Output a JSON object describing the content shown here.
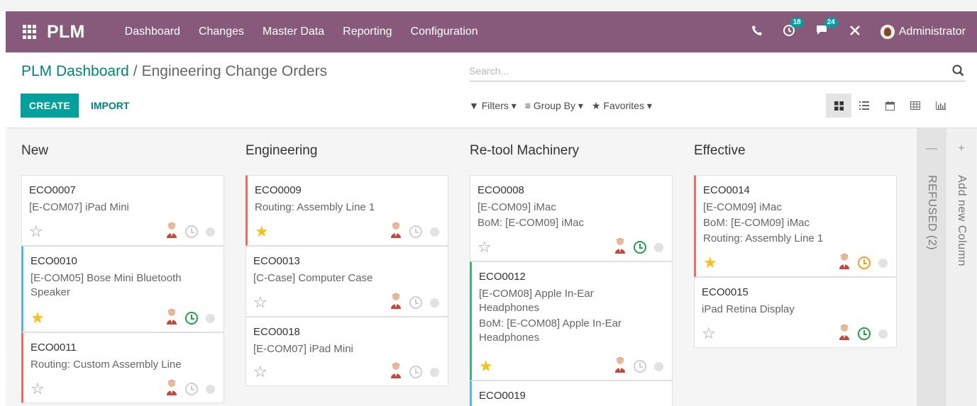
{
  "navbar": {
    "brand": "PLM",
    "menu": [
      "Dashboard",
      "Changes",
      "Master Data",
      "Reporting",
      "Configuration"
    ],
    "activities_count": "18",
    "messages_count": "24",
    "user": "Administrator",
    "background": "#875a7b"
  },
  "breadcrumb": {
    "parent": "PLM Dashboard",
    "separator": "/",
    "current": "Engineering Change Orders"
  },
  "search": {
    "placeholder": "Search..."
  },
  "buttons": {
    "create": "CREATE",
    "import": "IMPORT"
  },
  "filters": {
    "filters": "Filters",
    "group_by": "Group By",
    "favorites": "Favorites"
  },
  "kanban": {
    "columns": [
      {
        "title": "New",
        "cards": [
          {
            "ref": "ECO0007",
            "lines": [
              "[E-COM07] iPad Mini"
            ],
            "starred": false,
            "activity": "none",
            "color": ""
          },
          {
            "ref": "ECO0010",
            "lines": [
              "[E-COM05] Bose Mini Bluetooth Speaker"
            ],
            "starred": true,
            "activity": "green",
            "color": "blue"
          },
          {
            "ref": "ECO0011",
            "lines": [
              "Routing: Custom Assembly Line"
            ],
            "starred": false,
            "activity": "none",
            "color": "red"
          }
        ]
      },
      {
        "title": "Engineering",
        "cards": [
          {
            "ref": "ECO0009",
            "lines": [
              "Routing: Assembly Line 1"
            ],
            "starred": true,
            "activity": "none",
            "color": "red"
          },
          {
            "ref": "ECO0013",
            "lines": [
              "[C-Case] Computer Case"
            ],
            "starred": false,
            "activity": "none",
            "color": ""
          },
          {
            "ref": "ECO0018",
            "lines": [
              "[E-COM07] iPad Mini"
            ],
            "starred": false,
            "activity": "none",
            "color": ""
          }
        ]
      },
      {
        "title": "Re-tool Machinery",
        "cards": [
          {
            "ref": "ECO0008",
            "lines": [
              "[E-COM09] iMac",
              "BoM: [E-COM09] iMac"
            ],
            "starred": false,
            "activity": "green",
            "color": ""
          },
          {
            "ref": "ECO0012",
            "lines": [
              "[E-COM08] Apple In-Ear Headphones",
              "BoM: [E-COM08] Apple In-Ear Headphones"
            ],
            "starred": true,
            "activity": "none",
            "color": "green"
          },
          {
            "ref": "ECO0019",
            "lines": [],
            "starred": false,
            "activity": "none",
            "color": "blue"
          }
        ]
      },
      {
        "title": "Effective",
        "cards": [
          {
            "ref": "ECO0014",
            "lines": [
              "[E-COM09] iMac",
              "BoM: [E-COM09] iMac",
              "Routing: Assembly Line 1"
            ],
            "starred": true,
            "activity": "orange",
            "color": "red"
          },
          {
            "ref": "ECO0015",
            "lines": [
              "iPad Retina Display"
            ],
            "starred": false,
            "activity": "green",
            "color": ""
          }
        ]
      }
    ],
    "folded_column": "REFUSED (2)",
    "add_column": "Add new Column"
  }
}
